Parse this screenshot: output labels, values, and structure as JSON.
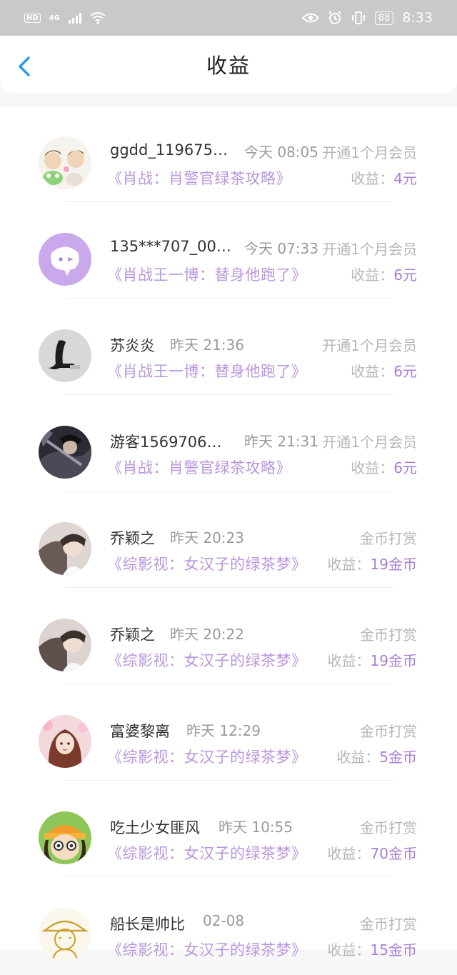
{
  "status_bar": {
    "hd": "HD",
    "network": "4G",
    "battery": "88",
    "time": "8:33"
  },
  "header": {
    "title": "收益"
  },
  "records": [
    {
      "name": "ggdd_119675…",
      "time": "今天 08:05",
      "type": "开通1个月会员",
      "book": "《肖战：肖警官绿茶攻略》",
      "earn_label": "收益：",
      "earn_amount": "4元"
    },
    {
      "name": "135***707_00…",
      "time": "今天 07:33",
      "type": "开通1个月会员",
      "book": "《肖战王一博：替身他跑了》",
      "earn_label": "收益：",
      "earn_amount": "6元"
    },
    {
      "name": "苏炎炎",
      "time": "昨天 21:36",
      "type": "开通1个月会员",
      "book": "《肖战王一博：替身他跑了》",
      "earn_label": "收益：",
      "earn_amount": "6元"
    },
    {
      "name": "游客1569706…",
      "time": "昨天 21:31",
      "type": "开通1个月会员",
      "book": "《肖战：肖警官绿茶攻略》",
      "earn_label": "收益：",
      "earn_amount": "6元"
    },
    {
      "name": "乔颖之",
      "time": "昨天 20:23",
      "type": "金币打赏",
      "book": "《综影视：女汉子的绿茶梦》",
      "earn_label": "收益：",
      "earn_amount": "19金币"
    },
    {
      "name": "乔颖之",
      "time": "昨天 20:22",
      "type": "金币打赏",
      "book": "《综影视：女汉子的绿茶梦》",
      "earn_label": "收益：",
      "earn_amount": "19金币"
    },
    {
      "name": "富婆黎离",
      "time": "昨天 12:29",
      "type": "金币打赏",
      "book": "《综影视：女汉子的绿茶梦》",
      "earn_label": "收益：",
      "earn_amount": "5金币"
    },
    {
      "name": "吃土少女匪风",
      "time": "昨天 10:55",
      "type": "金币打赏",
      "book": "《综影视：女汉子的绿茶梦》",
      "earn_label": "收益：",
      "earn_amount": "70金币"
    },
    {
      "name": "船长是帅比",
      "time": "02-08",
      "type": "金币打赏",
      "book": "《综影视：女汉子的绿茶梦》",
      "earn_label": "收益：",
      "earn_amount": "15金币"
    }
  ]
}
